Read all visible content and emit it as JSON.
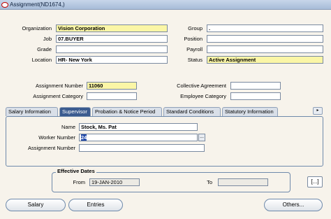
{
  "window": {
    "title": "Assignment(ND1674,)"
  },
  "fields": {
    "organization": {
      "label": "Organization",
      "value": "Vision Corporation"
    },
    "job": {
      "label": "Job",
      "value": "07.BUYER"
    },
    "grade": {
      "label": "Grade",
      "value": ""
    },
    "location": {
      "label": "Location",
      "value": "HR- New York"
    },
    "group": {
      "label": "Group",
      "value": "."
    },
    "position": {
      "label": "Position",
      "value": ""
    },
    "payroll": {
      "label": "Payroll",
      "value": ""
    },
    "status": {
      "label": "Status",
      "value": "Active Assignment"
    },
    "assignment_number": {
      "label": "Assignment Number",
      "value": "11060"
    },
    "assignment_category": {
      "label": "Assignment Category",
      "value": ""
    },
    "collective_agreement": {
      "label": "Collective Agreement",
      "value": ""
    },
    "employee_category": {
      "label": "Employee Category",
      "value": ""
    }
  },
  "tabs": [
    {
      "label": "Salary Information",
      "active": false
    },
    {
      "label": "Supervisor",
      "active": true
    },
    {
      "label": "Probation & Notice Period",
      "active": false
    },
    {
      "label": "Standard Conditions",
      "active": false
    },
    {
      "label": "Statutory Information",
      "active": false
    }
  ],
  "tab_scroll": "▸",
  "supervisor": {
    "name": {
      "label": "Name",
      "value": "Stock, Ms. Pat"
    },
    "worker_number": {
      "label": "Worker Number",
      "value": "24"
    },
    "assignment_number": {
      "label": "Assignment Number",
      "value": ""
    },
    "lov_button": "..."
  },
  "effective_dates": {
    "title": "Effective Dates",
    "from_label": "From",
    "from_value": "19-JAN-2010",
    "to_label": "To",
    "to_value": ""
  },
  "multi_button": "[...]",
  "buttons": {
    "salary": "Salary",
    "entries": "Entries",
    "others": "Others..."
  },
  "colors": {
    "required_field": "#fbf6a6",
    "active_tab": "#3b5b8f",
    "background": "#f7f3eb"
  }
}
